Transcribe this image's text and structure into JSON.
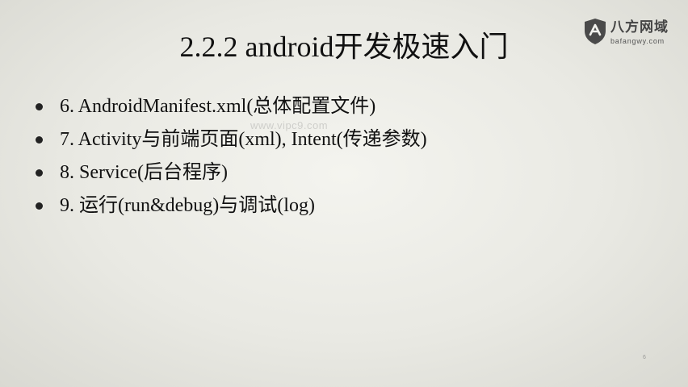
{
  "slide": {
    "title": "2.2.2 android开发极速入门",
    "bullets": [
      {
        "text": "6. AndroidManifest.xml(总体配置文件)"
      },
      {
        "text": "7. Activity与前端页面(xml), Intent(传递参数)"
      },
      {
        "text": "8. Service(后台程序)"
      },
      {
        "text": "9. 运行(run&debug)与调试(log)"
      }
    ],
    "page_number": "6"
  },
  "watermark": {
    "center_text": "www.vipc9.com"
  },
  "logo": {
    "name": "八方网域",
    "url": "bafangwy.com",
    "icon": "shield-icon"
  },
  "colors": {
    "background": "#ededE8",
    "text": "#111111",
    "logo_gray": "#444444"
  }
}
